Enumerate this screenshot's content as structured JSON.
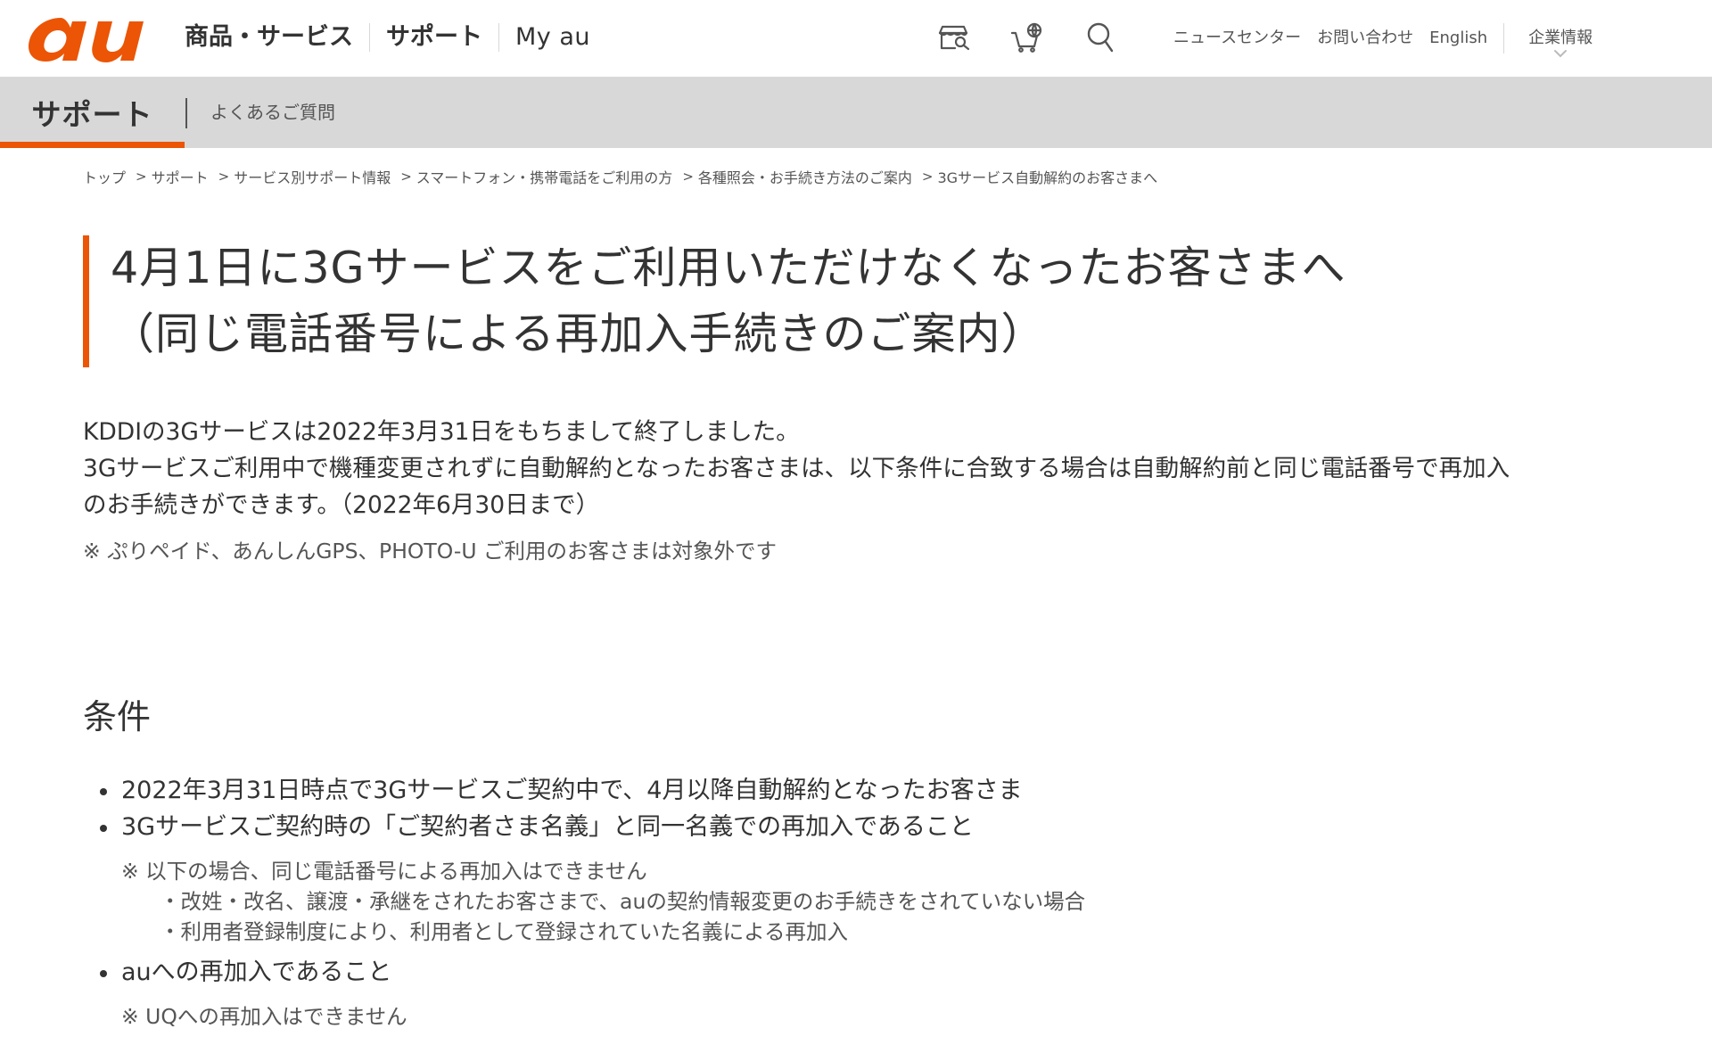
{
  "colors": {
    "brand_orange": "#eb5505",
    "text_primary": "#333333",
    "text_secondary": "#555555",
    "subheader_bg": "#d8d8d8"
  },
  "header": {
    "logo_text": "au",
    "nav": [
      {
        "label": "商品・サービス"
      },
      {
        "label": "サポート"
      },
      {
        "label": "My au"
      }
    ],
    "icons": [
      {
        "name": "shop-search-icon"
      },
      {
        "name": "online-shop-cart-icon"
      },
      {
        "name": "search-icon"
      }
    ],
    "util_links": [
      {
        "label": "ニュースセンター"
      },
      {
        "label": "お問い合わせ"
      },
      {
        "label": "English"
      }
    ],
    "corporate": {
      "label": "企業情報",
      "icon": "chevron-down-icon"
    }
  },
  "subheader": {
    "title": "サポート",
    "link": "よくあるご質問"
  },
  "breadcrumb": [
    "トップ",
    "サポート",
    "サービス別サポート情報",
    "スマートフォン・携帯電話をご利用の方",
    "各種照会・お手続き方法のご案内",
    "3Gサービス自動解約のお客さまへ"
  ],
  "breadcrumb_separator": ">",
  "title": {
    "line1": "4月1日に3Gサービスをご利用いただけなくなったお客さまへ",
    "line2": "（同じ電話番号による再加入手続きのご案内）"
  },
  "intro": {
    "line1": "KDDIの3Gサービスは2022年3月31日をもちまして終了しました。",
    "line2": "3Gサービスご利用中で機種変更されずに自動解約となったお客さまは、以下条件に合致する場合は自動解約前と同じ電話番号で再加入",
    "line3": "のお手続きができます。（2022年6月30日まで）",
    "note": "※  ぷりペイド、あんしんGPS、PHOTO-U ご利用のお客さまは対象外です"
  },
  "conditions": {
    "heading": "条件",
    "item1": "2022年3月31日時点で3Gサービスご契約中で、4月以降自動解約となったお客さま",
    "item2": "3Gサービスご契約時の「ご契約者さま名義」と同一名義での再加入であること",
    "item2_note": "※  以下の場合、同じ電話番号による再加入はできません",
    "item2_sub1": "・改姓・改名、譲渡・承継をされたお客さまで、auの契約情報変更のお手続きをされていない場合",
    "item2_sub2": "・利用者登録制度により、利用者として登録されていた名義による再加入",
    "item3": "auへの再加入であること",
    "item3_note": "※  UQへの再加入はできません"
  }
}
